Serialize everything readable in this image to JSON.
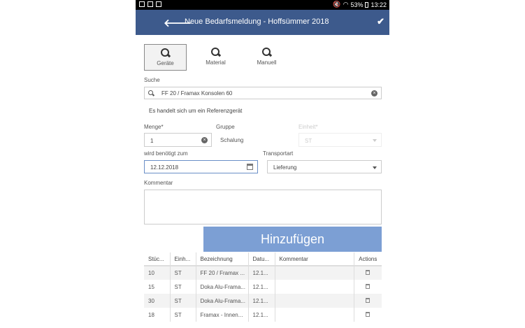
{
  "statusbar": {
    "battery": "53%",
    "time": "13:22"
  },
  "appbar": {
    "title": "Neue Bedarfsmeldung - Hoffsümmer 2018"
  },
  "tabs": [
    {
      "label": "Geräte",
      "active": true
    },
    {
      "label": "Material",
      "active": false
    },
    {
      "label": "Manuell",
      "active": false
    }
  ],
  "search": {
    "label": "Suche",
    "value": "FF 20 / Framax Konsolen 60"
  },
  "hint": "Es handelt sich um ein Referenzgerät",
  "menge": {
    "label": "Menge*",
    "value": "1"
  },
  "gruppe": {
    "label": "Gruppe",
    "value": "Schalung"
  },
  "einheit": {
    "label": "Einheit*",
    "value": "ST"
  },
  "date": {
    "label": "wird benötigt zum",
    "value": "12.12.2018"
  },
  "transport": {
    "label": "Transportart",
    "value": "Lieferung"
  },
  "kommentar": {
    "label": "Kommentar",
    "value": ""
  },
  "add_button": "Hinzufügen",
  "table": {
    "headers": [
      "Stüc...",
      "Einh...",
      "Bezeichnung",
      "Datu...",
      "Kommentar",
      "Actions"
    ],
    "rows": [
      [
        "10",
        "ST",
        "FF 20 / Framax ...",
        "12.1...",
        ""
      ],
      [
        "15",
        "ST",
        "Doka Alu-Frama...",
        "12.1...",
        ""
      ],
      [
        "30",
        "ST",
        "Doka Alu-Frama...",
        "12.1...",
        ""
      ],
      [
        "18",
        "ST",
        "Framax - Innen...",
        "12.1...",
        ""
      ]
    ]
  }
}
